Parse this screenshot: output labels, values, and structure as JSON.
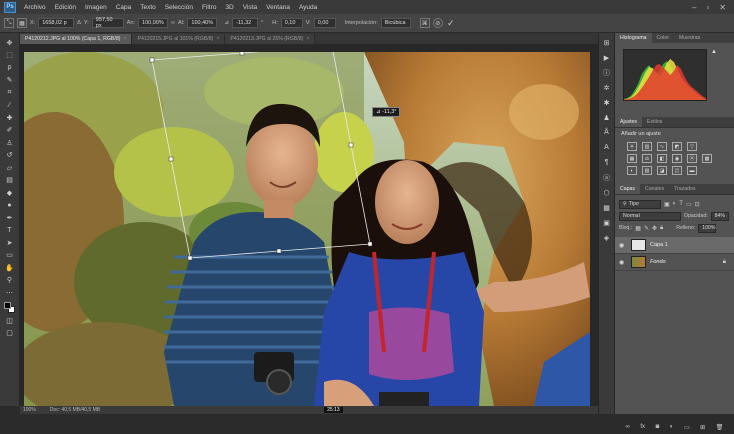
{
  "menubar": {
    "logo": "Ps",
    "items": [
      "Archivo",
      "Edición",
      "Imagen",
      "Capa",
      "Texto",
      "Selección",
      "Filtro",
      "3D",
      "Vista",
      "Ventana",
      "Ayuda"
    ]
  },
  "options": {
    "x_label": "X:",
    "x_value": "1658,02 p",
    "y_label": "Y:",
    "y_value": "957,50 px",
    "w_label": "An:",
    "w_value": "100,00%",
    "h_label": "Al:",
    "h_value": "100,40%",
    "angle_value": "-11,32",
    "h_skew_label": "H:",
    "h_skew_value": "0,10",
    "v_skew_label": "V:",
    "v_skew_value": "0,00",
    "interp_label": "Interpolación:",
    "interp_value": "Bicúbica"
  },
  "tabs": [
    {
      "label": "P4120212.JPG al 100% (Capa 1, RGB/8)",
      "active": true
    },
    {
      "label": "P4120215.JPG al 101% (RGB/8)",
      "active": false
    },
    {
      "label": "P4120213.JPG al 25% (RGB/8)",
      "active": false
    }
  ],
  "angle_readout": "⊿ -11,3°",
  "status": {
    "zoom": "100%",
    "doc": "Doc: 40,5 MB/40,5 MB",
    "timecode": "25:13"
  },
  "panels": {
    "histogram_tabs": [
      "Histograma",
      "Color",
      "Muestras"
    ],
    "adjust_tabs": [
      "Ajustes",
      "Estilos"
    ],
    "adjust_title": "Añadir un ajuste",
    "layer_tabs": [
      "Capas",
      "Canales",
      "Trazados"
    ],
    "filter_value": "Tipo",
    "blend_mode": "Normal",
    "opacity_label": "Opacidad:",
    "opacity_value": "84%",
    "lock_label": "Bloq.:",
    "fill_label": "Relleno:",
    "fill_value": "100%",
    "layers": [
      {
        "name": "Capa 1",
        "selected": true
      },
      {
        "name": "Fondo",
        "selected": false
      }
    ]
  },
  "colors": {
    "accent": "#2c5f8a",
    "selection": "#6a6a6a"
  },
  "chart_data": {
    "type": "area",
    "title": "",
    "series": [
      {
        "name": "",
        "color": "#35c33a",
        "values": [
          2,
          4,
          9,
          20,
          33,
          52,
          62,
          70,
          58,
          50,
          60,
          72,
          78,
          70,
          55,
          40,
          30,
          22,
          18,
          14,
          10,
          6,
          3,
          1
        ]
      },
      {
        "name": "",
        "color": "#f0e040",
        "values": [
          1,
          3,
          6,
          14,
          26,
          40,
          55,
          66,
          64,
          55,
          48,
          58,
          74,
          82,
          76,
          62,
          46,
          36,
          28,
          22,
          16,
          10,
          5,
          2
        ]
      },
      {
        "name": "",
        "color": "#e23b2f",
        "values": [
          1,
          2,
          4,
          8,
          15,
          24,
          35,
          46,
          58,
          70,
          72,
          65,
          58,
          50,
          58,
          70,
          62,
          46,
          34,
          26,
          20,
          14,
          8,
          3
        ]
      }
    ]
  }
}
